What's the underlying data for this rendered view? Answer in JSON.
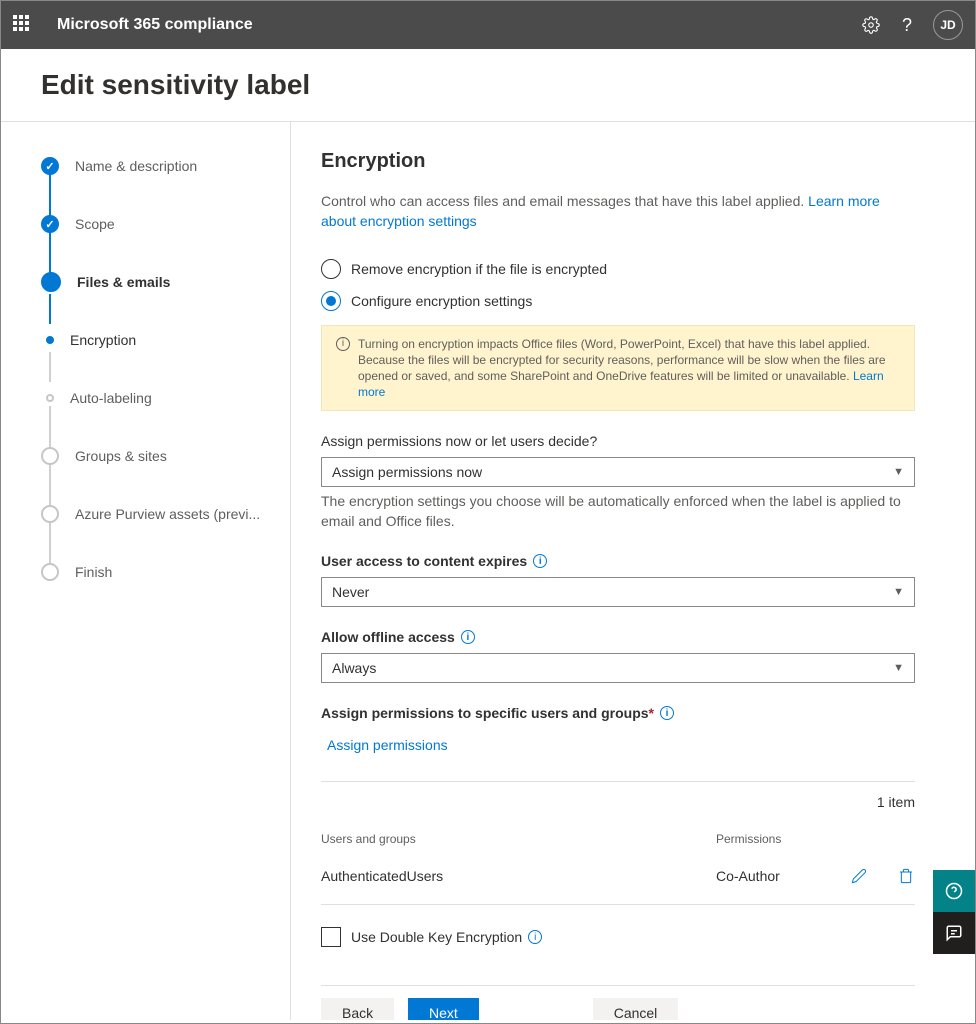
{
  "topbar": {
    "app": "Microsoft 365 compliance",
    "avatar": "JD"
  },
  "page": {
    "title": "Edit sensitivity label"
  },
  "steps": [
    {
      "label": "Name & description",
      "state": "done"
    },
    {
      "label": "Scope",
      "state": "done"
    },
    {
      "label": "Files & emails",
      "state": "active"
    },
    {
      "label": "Encryption",
      "state": "sub-active"
    },
    {
      "label": "Auto-labeling",
      "state": "sub"
    },
    {
      "label": "Groups & sites",
      "state": "future"
    },
    {
      "label": "Azure Purview assets (previ...",
      "state": "future"
    },
    {
      "label": "Finish",
      "state": "future"
    }
  ],
  "main": {
    "heading": "Encryption",
    "desc": "Control who can access files and email messages that have this label applied. ",
    "desc_link": "Learn more about encryption settings",
    "radio1": "Remove encryption if the file is encrypted",
    "radio2": "Configure encryption settings",
    "banner": "Turning on encryption impacts Office files (Word, PowerPoint, Excel) that have this label applied. Because the files will be encrypted for security reasons, performance will be slow when the files are opened or saved, and some SharePoint and OneDrive features will be limited or unavailable.  ",
    "banner_link": "Learn more",
    "assign_label": "Assign permissions now or let users decide?",
    "assign_value": "Assign permissions now",
    "assign_helper": "The encryption settings you choose will be automatically enforced when the label is applied to email and Office files.",
    "expires_label": "User access to content expires",
    "expires_value": "Never",
    "offline_label": "Allow offline access",
    "offline_value": "Always",
    "groups_label": "Assign permissions to specific users and groups ",
    "assign_link": "Assign permissions",
    "count": "1 item",
    "col_ug": "Users and groups",
    "col_perm": "Permissions",
    "row_ug": "AuthenticatedUsers",
    "row_perm": "Co-Author",
    "dke": "Use Double Key Encryption"
  },
  "footer": {
    "back": "Back",
    "next": "Next",
    "cancel": "Cancel"
  }
}
